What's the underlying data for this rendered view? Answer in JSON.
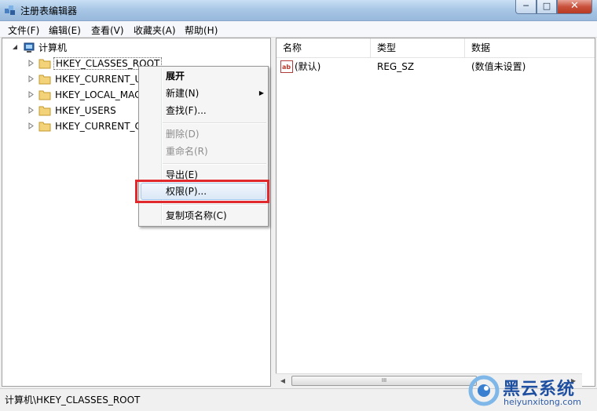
{
  "window": {
    "title": "注册表编辑器",
    "min_glyph": "─",
    "max_glyph": "□",
    "close_glyph": "✕"
  },
  "menubar": [
    "文件(F)",
    "编辑(E)",
    "查看(V)",
    "收藏夹(A)",
    "帮助(H)"
  ],
  "tree": {
    "root": "计算机",
    "keys": [
      "HKEY_CLASSES_ROOT",
      "HKEY_CURRENT_U",
      "HKEY_LOCAL_MAC",
      "HKEY_USERS",
      "HKEY_CURRENT_C"
    ]
  },
  "list": {
    "columns": [
      "名称",
      "类型",
      "数据"
    ],
    "rows": [
      {
        "icon": "ab",
        "name": "(默认)",
        "type": "REG_SZ",
        "data": "(数值未设置)"
      }
    ]
  },
  "context_menu": {
    "items": [
      {
        "label": "展开",
        "bold": true
      },
      {
        "label": "新建(N)",
        "submenu_arrow": "▶"
      },
      {
        "label": "查找(F)..."
      },
      {
        "label": "删除(D)",
        "disabled": true
      },
      {
        "label": "重命名(R)",
        "disabled": true
      },
      {
        "label": "导出(E)"
      },
      {
        "label": "权限(P)...",
        "hovered": true
      },
      {
        "label": "复制项名称(C)"
      }
    ]
  },
  "statusbar": {
    "path": "计算机\\HKEY_CLASSES_ROOT"
  },
  "scrollbar": {
    "thumb_grip": "III"
  },
  "watermark": {
    "brand": "黑云系统",
    "url": "heiyunxitong.com"
  },
  "colors": {
    "highlight_border": "#e0282d",
    "selection": "#dbe8f7"
  }
}
